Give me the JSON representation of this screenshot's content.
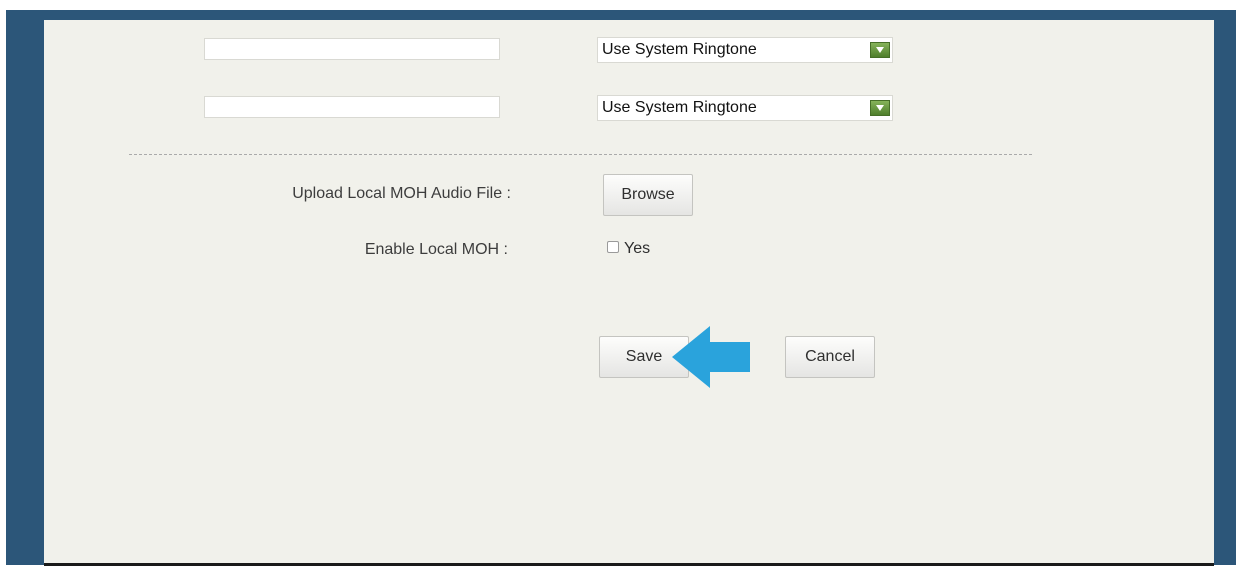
{
  "ringtone_rows": [
    {
      "text_value": "",
      "ringtone_select": "Use System Ringtone"
    },
    {
      "text_value": "",
      "ringtone_select": "Use System Ringtone"
    }
  ],
  "moh": {
    "upload_label": "Upload Local MOH Audio File :",
    "browse_button": "Browse",
    "enable_label": "Enable Local MOH :",
    "enable_option": "Yes",
    "enable_checked": false
  },
  "actions": {
    "save_button": "Save",
    "cancel_button": "Cancel"
  },
  "colors": {
    "frame": "#2c5679",
    "panel": "#f1f1eb",
    "select_arrow": "#5f8f38",
    "annotation_arrow": "#2aa3dc"
  },
  "annotation": {
    "icon": "arrow-left-icon",
    "points_to": "save-button"
  }
}
